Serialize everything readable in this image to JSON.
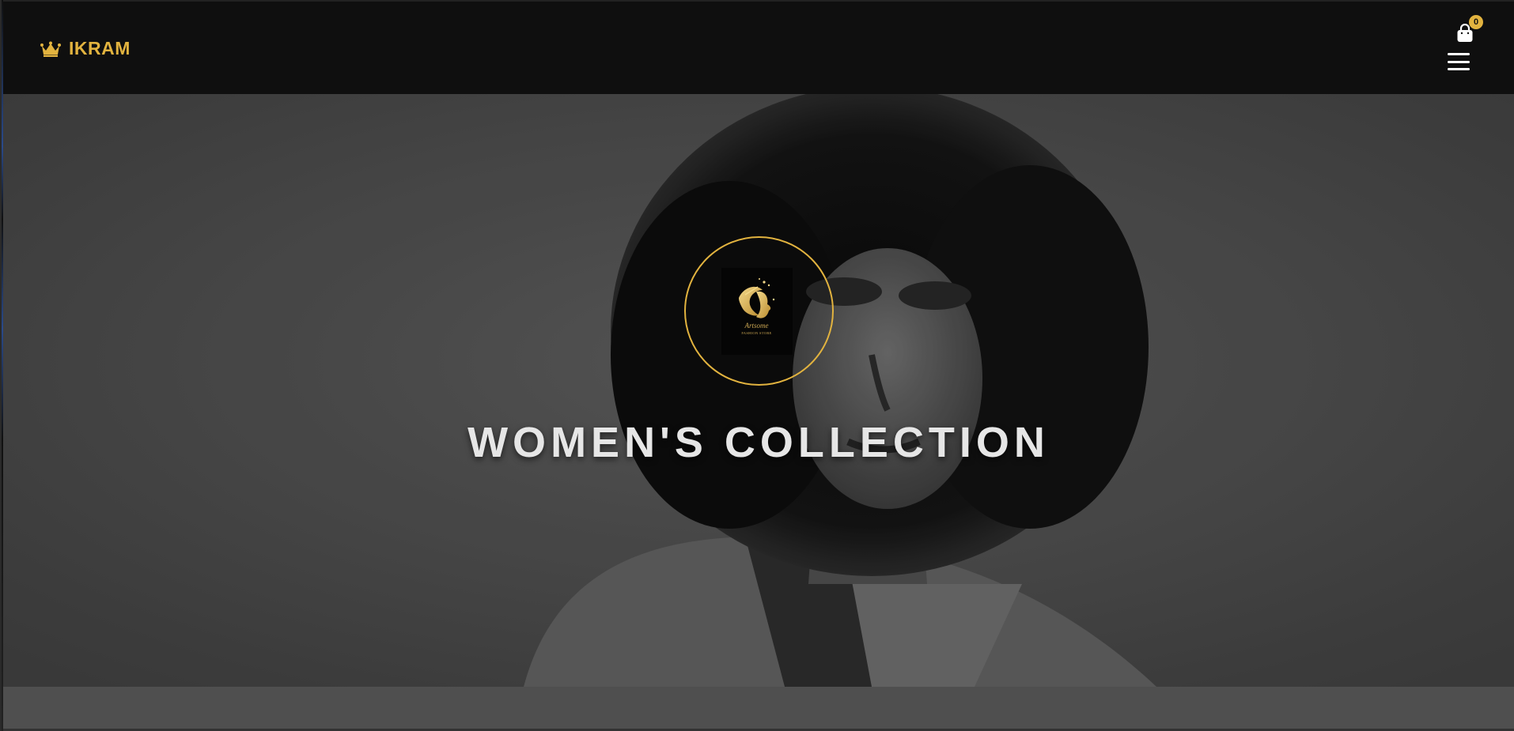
{
  "header": {
    "brand_name": "IKRAM",
    "brand_icon": "crown-icon",
    "cart_icon": "shopping-bag-icon",
    "cart_count": "0",
    "menu_icon": "hamburger-menu-icon"
  },
  "hero": {
    "title": "WOMEN'S COLLECTION",
    "emblem_script": "Artsome",
    "emblem_caption": "FASHION STORE",
    "emblem_icon": "woman-silhouette-logo-icon"
  },
  "colors": {
    "accent_gold": "#e2b33f",
    "header_bg": "#0f0f0f",
    "hero_bg": "#4a4a4a",
    "title_text": "#e6e6e6"
  }
}
